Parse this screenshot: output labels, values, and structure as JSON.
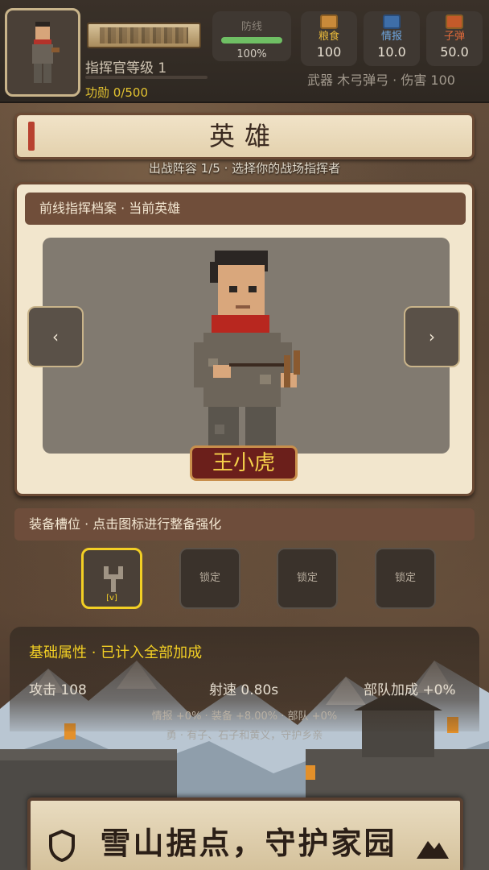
{
  "hud": {
    "rank_label": "指挥官等级 1",
    "merit": "功勋 0/500",
    "defense": {
      "label": "防线",
      "value": "100%",
      "fill": 1.0
    },
    "resources": [
      {
        "name": "粮食",
        "value": "100",
        "color": "#e7b73a",
        "icon": "grain-icon"
      },
      {
        "name": "情报",
        "value": "10.0",
        "color": "#6fa7e0",
        "icon": "intel-icon"
      },
      {
        "name": "子弹",
        "value": "50.0",
        "color": "#e06a3a",
        "icon": "bullet-icon"
      }
    ],
    "weapon_line": "武器 木弓弹弓 · 伤害 100"
  },
  "title": {
    "text": "英雄",
    "subtitle": "出战阵容 1/5 · 选择你的战场指挥者"
  },
  "hero_card": {
    "header": "前线指挥档案 · 当前英雄",
    "prev_label": "‹",
    "next_label": "›",
    "hero_name": "王小虎"
  },
  "equipment": {
    "header": "装备槽位 · 点击图标进行整备强化",
    "slots": [
      {
        "label": "",
        "level": "[v]",
        "active": true,
        "icon": "slingshot-icon"
      },
      {
        "label": "锁定",
        "active": false
      },
      {
        "label": "锁定",
        "active": false
      },
      {
        "label": "锁定",
        "active": false
      }
    ]
  },
  "stats": {
    "title": "基础属性 · 已计入全部加成",
    "attack": "攻击 108",
    "fire_rate": "射速 0.80s",
    "team_bonus": "部队加成 +0%",
    "bonus_line": "情报 +0% · 装备 +8.00% · 部队 +0%",
    "desc_line": "勇 · 有子、石子和黄义，守护乡亲"
  },
  "banner": {
    "text": "雪山据点，守护家园"
  }
}
